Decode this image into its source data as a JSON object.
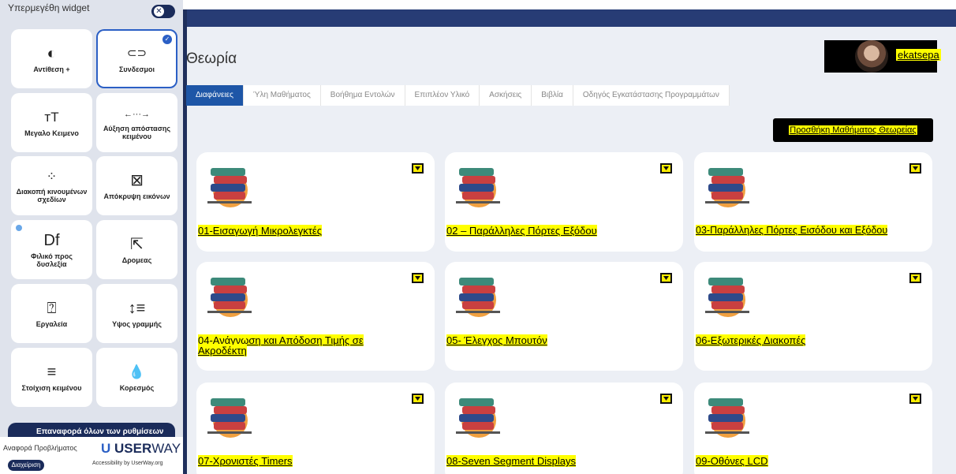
{
  "widget": {
    "header": "Υπερμεγέθη widget",
    "tiles": [
      {
        "label": "Αντίθεση +",
        "icon": "◐",
        "icon_name": "contrast-icon"
      },
      {
        "label": "Συνδεσμοι",
        "icon": "⊂⊃",
        "icon_name": "link-icon"
      },
      {
        "label": "Μεγαλο Κειμενο",
        "icon": "тT",
        "icon_name": "text-size-icon"
      },
      {
        "label": "Αύξηση απόστασης κειμένου",
        "icon": "←···→",
        "icon_name": "text-spacing-icon"
      },
      {
        "label": "Διακοπή κινουμένων σχεδίων",
        "icon": "⁘",
        "icon_name": "pause-animations-icon"
      },
      {
        "label": "Απόκρυψη εικόνων",
        "icon": "⊠",
        "icon_name": "hide-images-icon"
      },
      {
        "label": "Φιλικό προς δυσλεξία",
        "icon": "Df",
        "icon_name": "dyslexia-icon"
      },
      {
        "label": "Δρομεας",
        "icon": "⇱",
        "icon_name": "cursor-icon"
      },
      {
        "label": "Εργαλεία",
        "icon": "⍰",
        "icon_name": "tools-icon"
      },
      {
        "label": "Υψος γραμμής",
        "icon": "↕≡",
        "icon_name": "line-height-icon"
      },
      {
        "label": "Στοίχιση κειμένου",
        "icon": "≡",
        "icon_name": "text-align-icon"
      },
      {
        "label": "Κορεσμός",
        "icon": "💧",
        "icon_name": "saturation-icon"
      }
    ],
    "reset_label": "Επαναφορά όλων των ρυθμίσεων",
    "report_label": "Αναφορά Προβλήματος",
    "manage_label": "Διαχείριση",
    "logo_u": "U",
    "logo_user": "USER",
    "logo_way": "WAY",
    "logo_sub": "Accessibility by UserWay.org"
  },
  "page": {
    "title": "Θεωρία",
    "username": "ekatsepa",
    "tabs": [
      "Διαφάνειες",
      "Ύλη Μαθήματος",
      "Βοήθημα Εντολών",
      "Επιπλέον Υλικό",
      "Ασκήσεις",
      "Βιβλία",
      "Οδηγός Εγκατάστασης Προγραμμάτων"
    ],
    "add_button": "Προσθήκη Μαθήματος Θεωρείας",
    "cards": [
      "01-Εισαγωγή Μικρολεγκτές",
      "02 – Παράλληλες Πόρτες Εξόδου",
      "03-Παράλληλες Πόρτες Εισόδου και Εξόδου",
      "04-Ανάγνωση και Απόδοση Τιμής σε Ακροδέκτη",
      "05- Έλεγχος Μπουτόν",
      "06-Εξωτερικές Διακοπές",
      "07-Χρονιστές Timers",
      "08-Seven Segment Displays",
      "09-Οθόνες LCD"
    ]
  },
  "colors": {
    "accent": "#1e56a7",
    "navy": "#1a2b5a",
    "highlight": "#ffff00"
  }
}
